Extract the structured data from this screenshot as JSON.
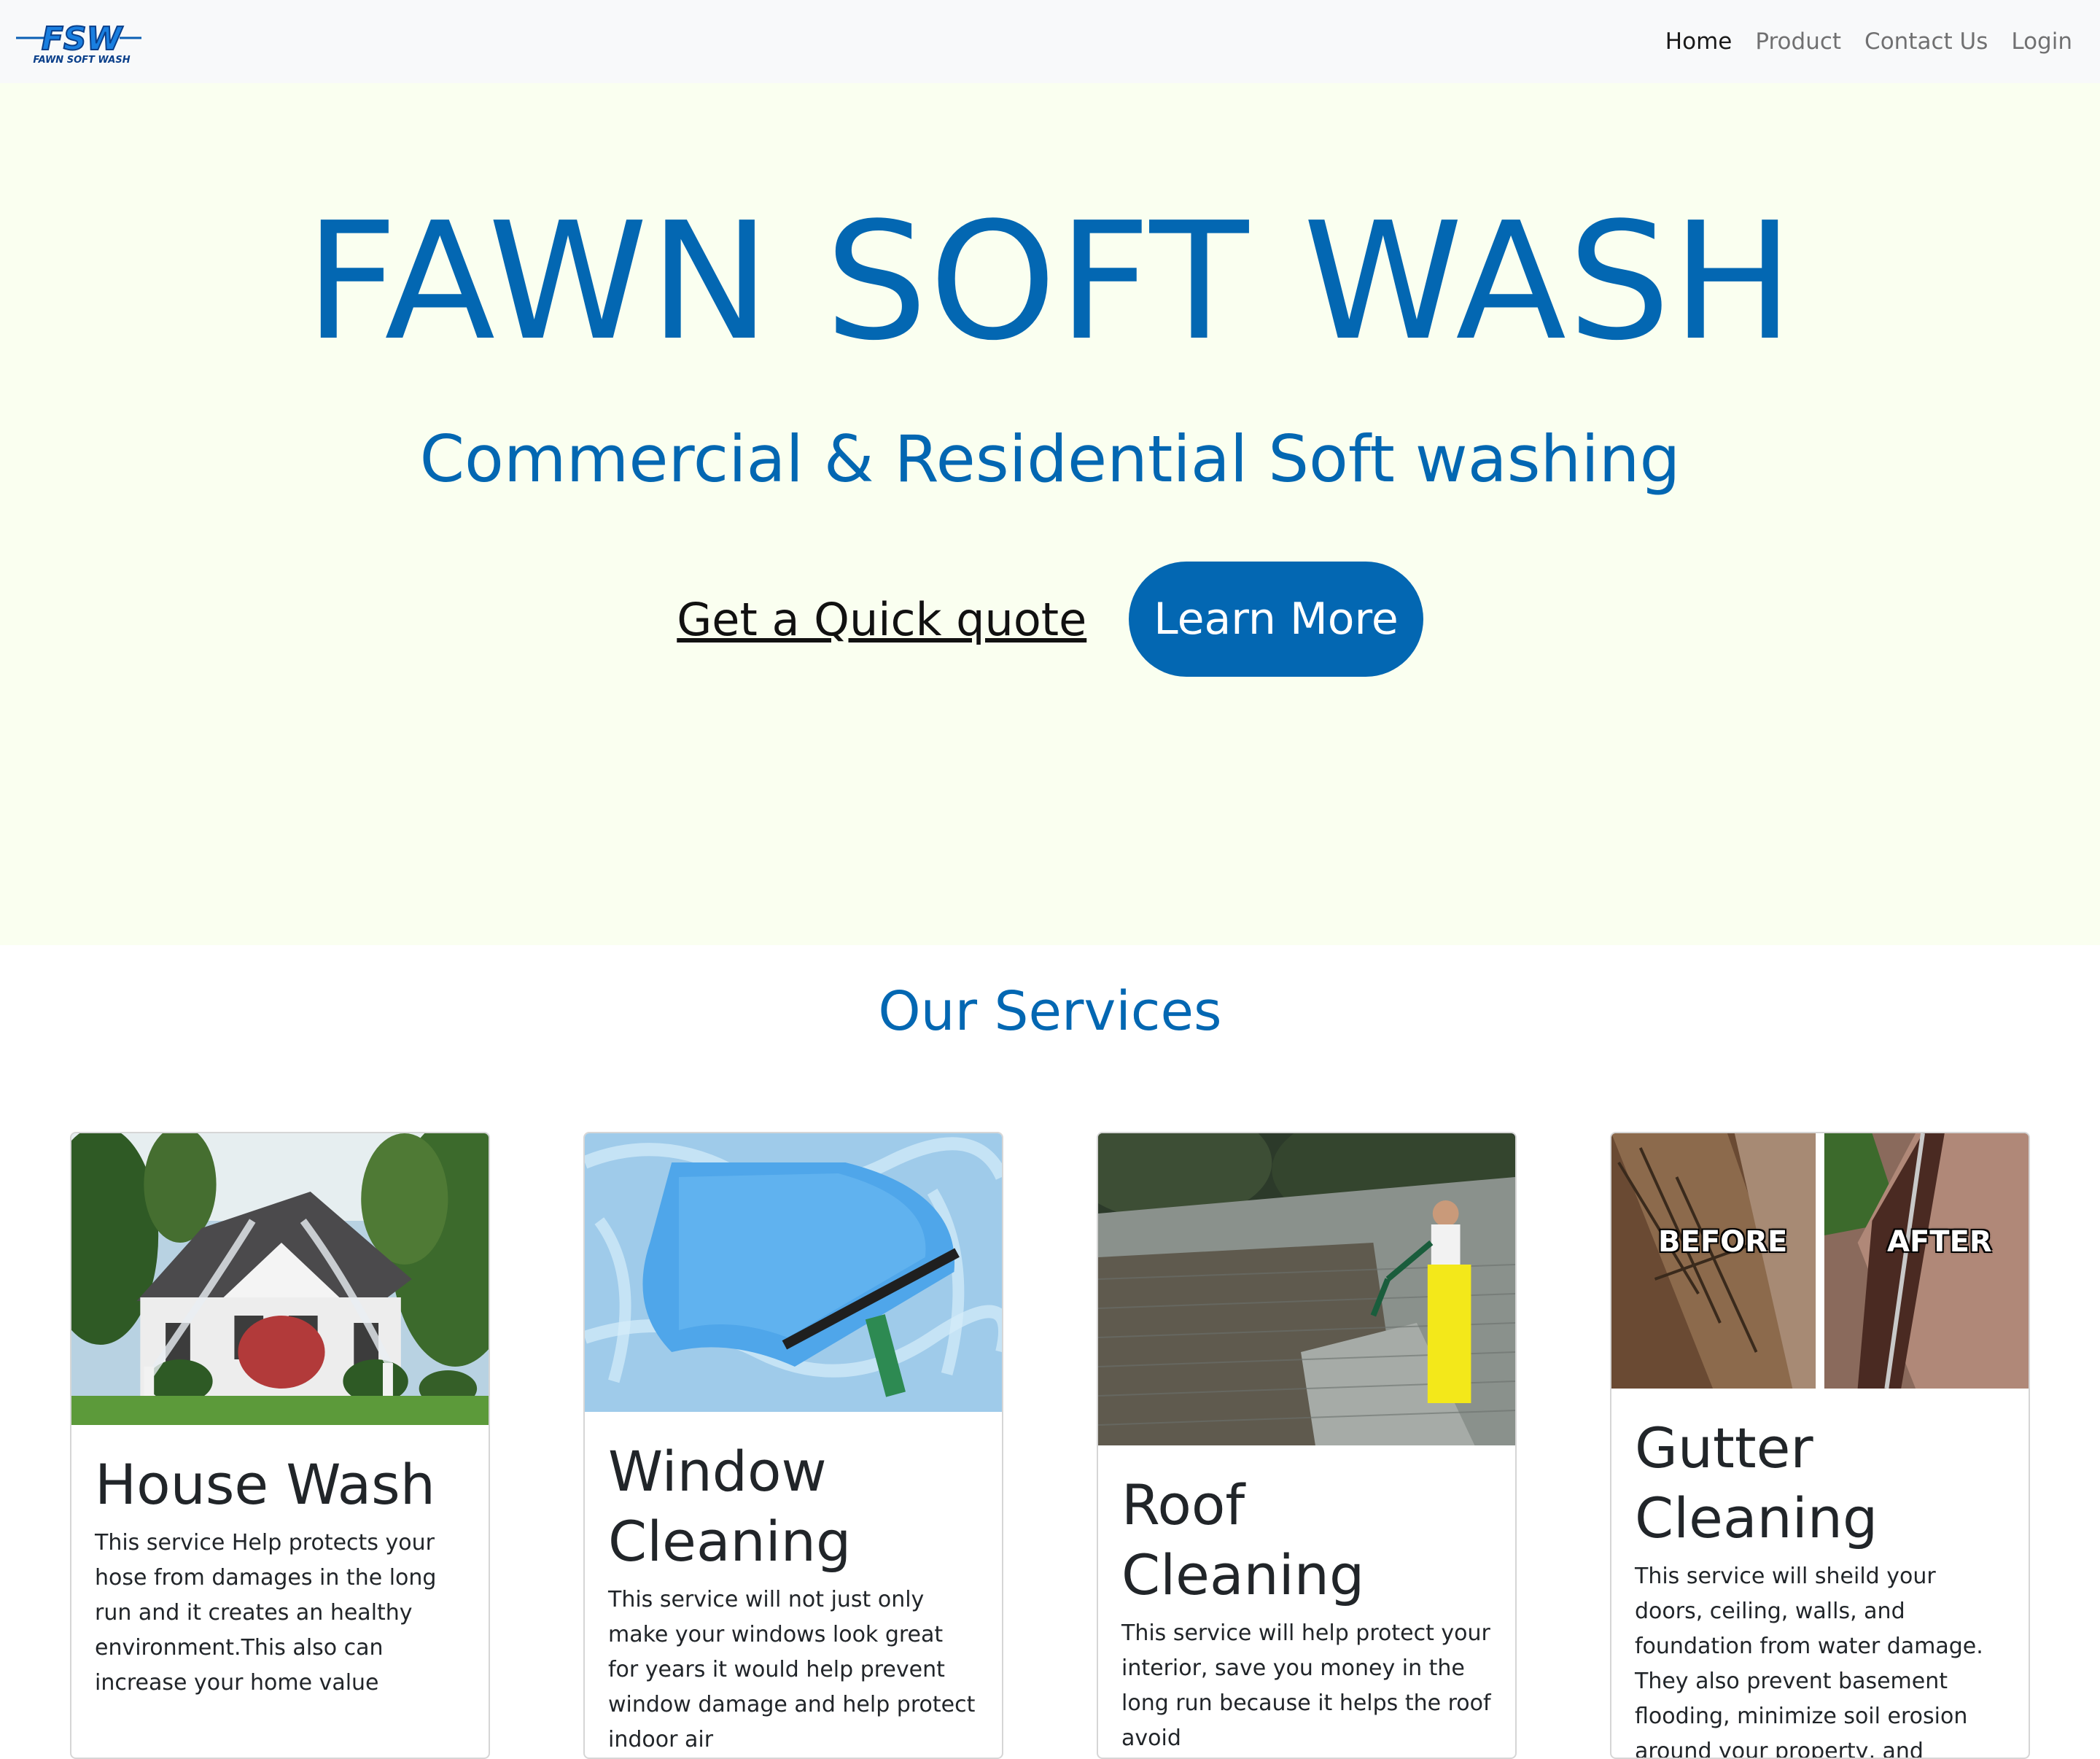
{
  "brand": {
    "logo_text": "FSW",
    "logo_subtext": "FAWN SOFT WASH",
    "color": "#0367b2"
  },
  "nav": {
    "items": [
      {
        "label": "Home",
        "active": true
      },
      {
        "label": "Product",
        "active": false
      },
      {
        "label": "Contact Us",
        "active": false
      },
      {
        "label": "Login",
        "active": false
      }
    ]
  },
  "hero": {
    "title": "FAWN SOFT WASH",
    "subtitle": "Commercial & Residential Soft washing",
    "quote_link": "Get a Quick quote",
    "learn_more": "Learn More",
    "background": "#fafff0"
  },
  "services": {
    "title": "Our Services",
    "cards": [
      {
        "title": "House Wash",
        "text": "This service Help protects your hose from damages in the long run and it creates an healthy environment.This also can increase your home value"
      },
      {
        "title": "Window Cleaning",
        "text": "This service will not just only make your windows look great for years it would help prevent window damage and help protect indoor air"
      },
      {
        "title": "Roof Cleaning",
        "text": "This service will help protect your interior, save you money in the long run because it helps the roof avoid"
      },
      {
        "title": "Gutter Cleaning",
        "text": "This service will sheild your doors, ceiling, walls, and foundation from water damage. They also prevent basement flooding, minimize soil erosion around your property, and",
        "before_label": "BEFORE",
        "after_label": "AFTER"
      }
    ]
  }
}
